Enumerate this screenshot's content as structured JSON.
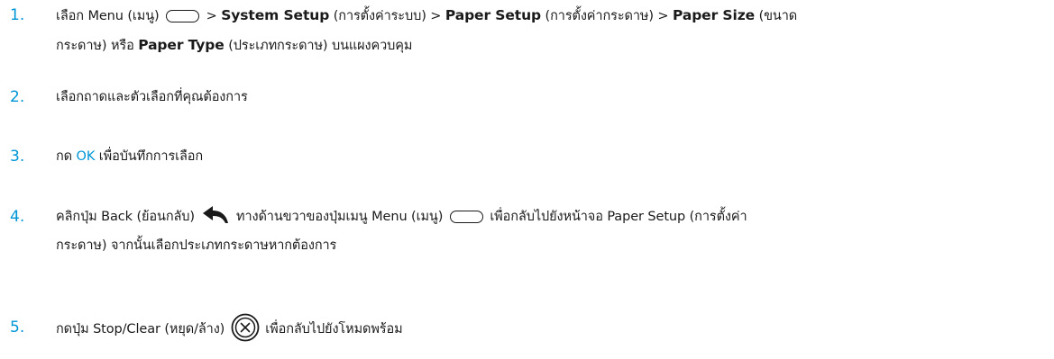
{
  "steps": [
    {
      "num": "1.",
      "menu": "เลือก Menu (เมนู)",
      "sep": ">",
      "system_setup": "System Setup",
      "system_setup_th": "(การตั้งค่าระบบ)",
      "paper_setup": "Paper Setup",
      "paper_setup_th": "(การตั้งค่ากระดาษ)",
      "paper_size": "Paper Size",
      "paper_size_th_a": "(ขนาด",
      "paper_size_th_b": "กระดาษ) หรือ",
      "paper_type": "Paper Type",
      "tail": "(ประเภทกระดาษ) บนแผงควบคุม"
    },
    {
      "num": "2.",
      "text": "เลือกถาดและตัวเลือกที่คุณต้องการ"
    },
    {
      "num": "3.",
      "pre": "กด",
      "ok": "OK",
      "post": "เพื่อบันทึกการเลือก"
    },
    {
      "num": "4.",
      "a": "คลิกปุ่ม Back (ย้อนกลับ)",
      "b": "ทางด้านขวาของปุ่มเมนู Menu (เมนู)",
      "c": "เพื่อกลับไปยังหน้าจอ Paper Setup (การตั้งค่า",
      "d": "กระดาษ) จากนั้นเลือกประเภทกระดาษหากต้องการ"
    },
    {
      "num": "5.",
      "a": "กดปุ่ม Stop/Clear (หยุด/ล้าง)",
      "b": "เพื่อกลับไปยังโหมดพร้อม"
    }
  ],
  "icons": {
    "menu": "menu-button-icon",
    "back": "back-arrow-icon",
    "stop": "stop-clear-icon"
  },
  "colors": {
    "accent": "#0096d6",
    "text": "#1a1a1a"
  }
}
